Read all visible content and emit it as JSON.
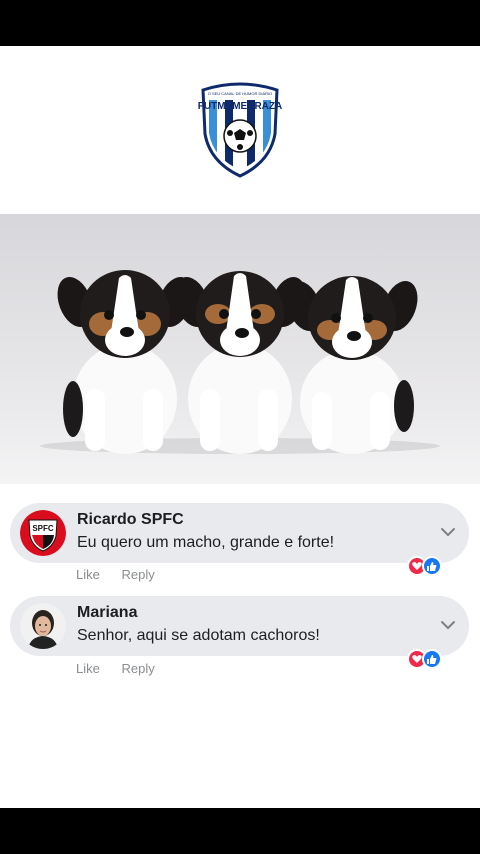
{
  "logo": {
    "top_text": "O SEU CANAL DE HUMOR DIÁRIO",
    "brand_name": "FUTMEMEBRAZA"
  },
  "comments": [
    {
      "author": "Ricardo SPFC",
      "text": "Eu quero um macho, grande e forte!",
      "avatar_text": "SPFC",
      "like_label": "Like",
      "reply_label": "Reply"
    },
    {
      "author": "Mariana",
      "text": "Senhor, aqui se adotam cachoros!",
      "like_label": "Like",
      "reply_label": "Reply"
    }
  ],
  "colors": {
    "comment_bg": "#e9eaee",
    "like_blue": "#1877f2",
    "love_red": "#f0284a",
    "spfc_red": "#d90d1e"
  },
  "icons": [
    "chevron-down-icon",
    "like-reaction-icon",
    "love-reaction-icon"
  ]
}
